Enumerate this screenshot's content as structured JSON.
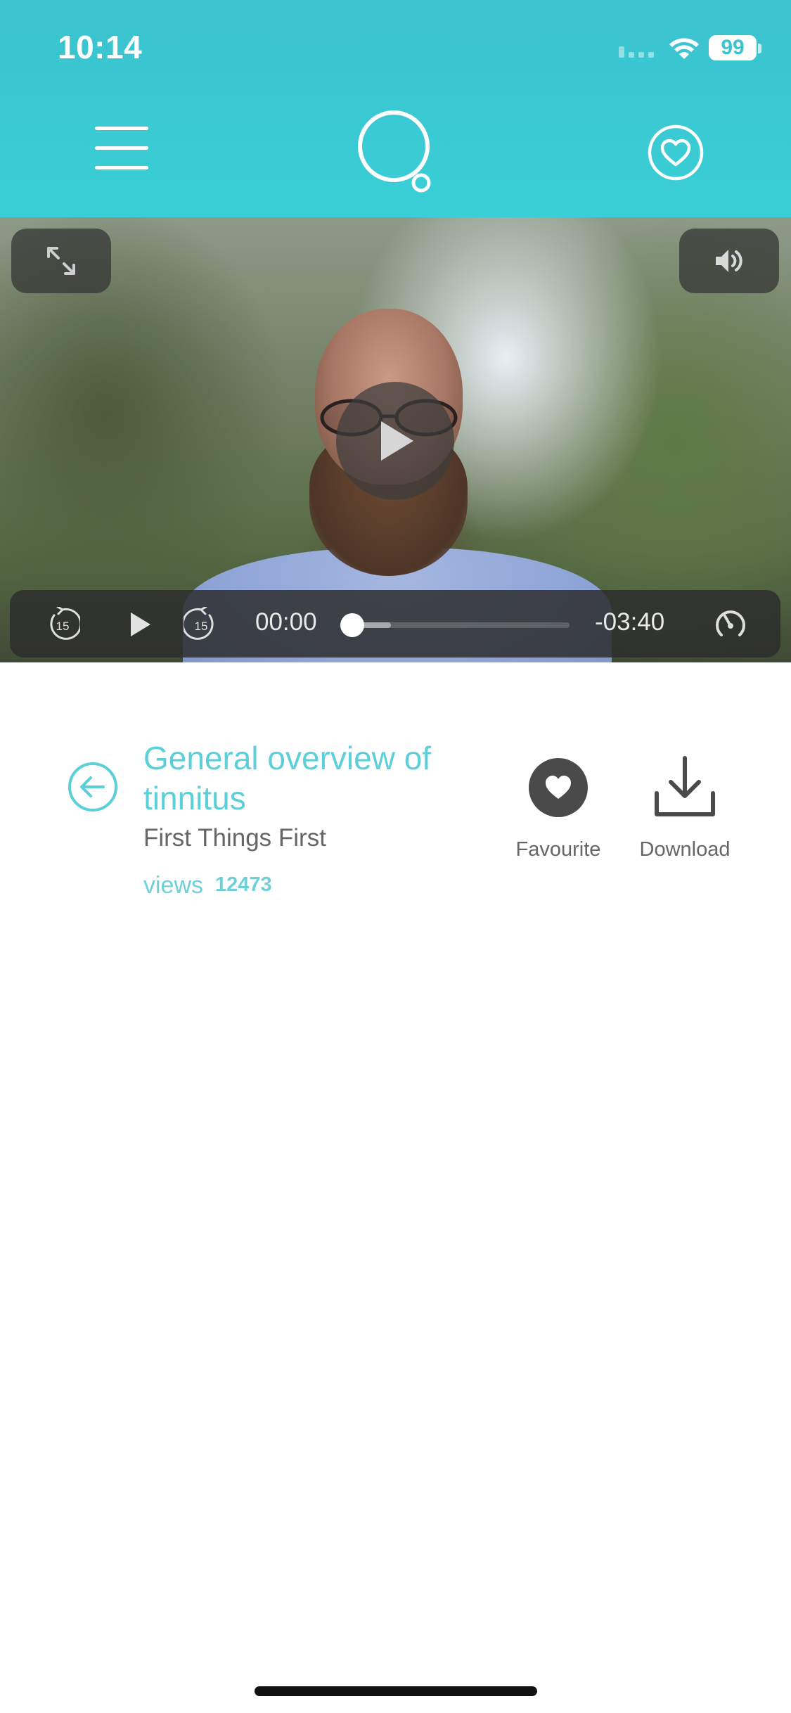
{
  "status_bar": {
    "time": "10:14",
    "battery": "99"
  },
  "header": {
    "menu_icon": "hamburger-menu-icon",
    "logo_icon": "thought-bubble-logo-icon",
    "favourites_icon": "heart-circle-icon",
    "background_color": "#39c8d3"
  },
  "video_player": {
    "icons": {
      "fullscreen": "expand-arrows-icon",
      "volume": "speaker-icon",
      "play": "play-icon",
      "rewind": "rewind-15-icon",
      "forward": "forward-15-icon",
      "speed": "playback-speed-icon"
    },
    "rewind_seconds": "15",
    "forward_seconds": "15",
    "current_time": "00:00",
    "remaining_time": "-03:40",
    "progress": 0.0,
    "buffered": 0.2
  },
  "video_info": {
    "title": "General overview of tinnitus",
    "category": "First Things First",
    "views_label": "views",
    "views_count": "12473",
    "accent_color": "#5ccfd9"
  },
  "actions": {
    "favourite_label": "Favourite",
    "download_label": "Download"
  }
}
